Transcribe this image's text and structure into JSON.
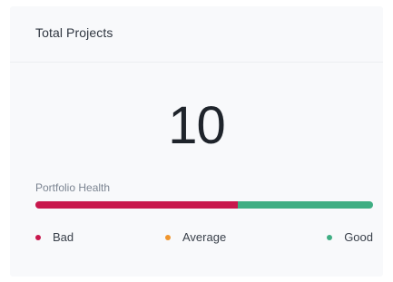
{
  "card": {
    "title": "Total Projects",
    "total": "10"
  },
  "portfolio_health": {
    "label": "Portfolio Health",
    "distribution": {
      "bad_fraction": 0.6,
      "good_fraction": 0.4
    },
    "legend": [
      {
        "label": "Bad",
        "color": "#c8184d",
        "icon": "status-dot-icon"
      },
      {
        "label": "Average",
        "color": "#f0962e",
        "icon": "status-dot-icon"
      },
      {
        "label": "Good",
        "color": "#3fae83",
        "icon": "status-dot-icon"
      }
    ]
  }
}
